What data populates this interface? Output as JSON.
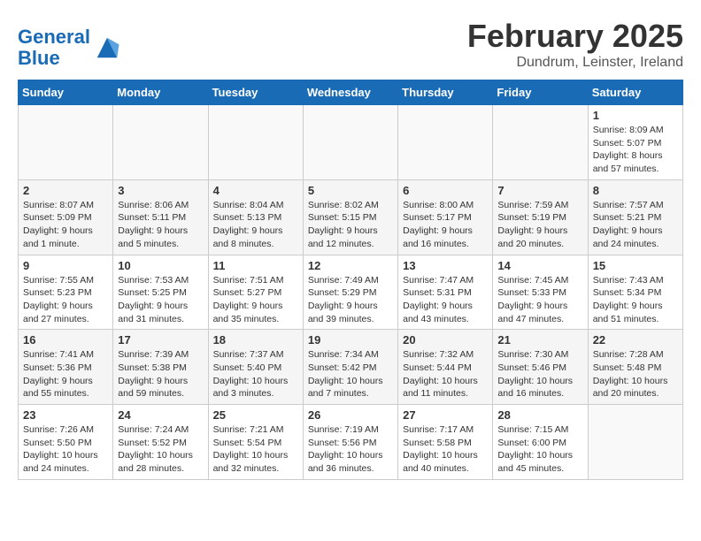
{
  "header": {
    "logo_line1": "General",
    "logo_line2": "Blue",
    "month_year": "February 2025",
    "location": "Dundrum, Leinster, Ireland"
  },
  "weekdays": [
    "Sunday",
    "Monday",
    "Tuesday",
    "Wednesday",
    "Thursday",
    "Friday",
    "Saturday"
  ],
  "weeks": [
    [
      {
        "day": "",
        "info": ""
      },
      {
        "day": "",
        "info": ""
      },
      {
        "day": "",
        "info": ""
      },
      {
        "day": "",
        "info": ""
      },
      {
        "day": "",
        "info": ""
      },
      {
        "day": "",
        "info": ""
      },
      {
        "day": "1",
        "info": "Sunrise: 8:09 AM\nSunset: 5:07 PM\nDaylight: 8 hours and 57 minutes."
      }
    ],
    [
      {
        "day": "2",
        "info": "Sunrise: 8:07 AM\nSunset: 5:09 PM\nDaylight: 9 hours and 1 minute."
      },
      {
        "day": "3",
        "info": "Sunrise: 8:06 AM\nSunset: 5:11 PM\nDaylight: 9 hours and 5 minutes."
      },
      {
        "day": "4",
        "info": "Sunrise: 8:04 AM\nSunset: 5:13 PM\nDaylight: 9 hours and 8 minutes."
      },
      {
        "day": "5",
        "info": "Sunrise: 8:02 AM\nSunset: 5:15 PM\nDaylight: 9 hours and 12 minutes."
      },
      {
        "day": "6",
        "info": "Sunrise: 8:00 AM\nSunset: 5:17 PM\nDaylight: 9 hours and 16 minutes."
      },
      {
        "day": "7",
        "info": "Sunrise: 7:59 AM\nSunset: 5:19 PM\nDaylight: 9 hours and 20 minutes."
      },
      {
        "day": "8",
        "info": "Sunrise: 7:57 AM\nSunset: 5:21 PM\nDaylight: 9 hours and 24 minutes."
      }
    ],
    [
      {
        "day": "9",
        "info": "Sunrise: 7:55 AM\nSunset: 5:23 PM\nDaylight: 9 hours and 27 minutes."
      },
      {
        "day": "10",
        "info": "Sunrise: 7:53 AM\nSunset: 5:25 PM\nDaylight: 9 hours and 31 minutes."
      },
      {
        "day": "11",
        "info": "Sunrise: 7:51 AM\nSunset: 5:27 PM\nDaylight: 9 hours and 35 minutes."
      },
      {
        "day": "12",
        "info": "Sunrise: 7:49 AM\nSunset: 5:29 PM\nDaylight: 9 hours and 39 minutes."
      },
      {
        "day": "13",
        "info": "Sunrise: 7:47 AM\nSunset: 5:31 PM\nDaylight: 9 hours and 43 minutes."
      },
      {
        "day": "14",
        "info": "Sunrise: 7:45 AM\nSunset: 5:33 PM\nDaylight: 9 hours and 47 minutes."
      },
      {
        "day": "15",
        "info": "Sunrise: 7:43 AM\nSunset: 5:34 PM\nDaylight: 9 hours and 51 minutes."
      }
    ],
    [
      {
        "day": "16",
        "info": "Sunrise: 7:41 AM\nSunset: 5:36 PM\nDaylight: 9 hours and 55 minutes."
      },
      {
        "day": "17",
        "info": "Sunrise: 7:39 AM\nSunset: 5:38 PM\nDaylight: 9 hours and 59 minutes."
      },
      {
        "day": "18",
        "info": "Sunrise: 7:37 AM\nSunset: 5:40 PM\nDaylight: 10 hours and 3 minutes."
      },
      {
        "day": "19",
        "info": "Sunrise: 7:34 AM\nSunset: 5:42 PM\nDaylight: 10 hours and 7 minutes."
      },
      {
        "day": "20",
        "info": "Sunrise: 7:32 AM\nSunset: 5:44 PM\nDaylight: 10 hours and 11 minutes."
      },
      {
        "day": "21",
        "info": "Sunrise: 7:30 AM\nSunset: 5:46 PM\nDaylight: 10 hours and 16 minutes."
      },
      {
        "day": "22",
        "info": "Sunrise: 7:28 AM\nSunset: 5:48 PM\nDaylight: 10 hours and 20 minutes."
      }
    ],
    [
      {
        "day": "23",
        "info": "Sunrise: 7:26 AM\nSunset: 5:50 PM\nDaylight: 10 hours and 24 minutes."
      },
      {
        "day": "24",
        "info": "Sunrise: 7:24 AM\nSunset: 5:52 PM\nDaylight: 10 hours and 28 minutes."
      },
      {
        "day": "25",
        "info": "Sunrise: 7:21 AM\nSunset: 5:54 PM\nDaylight: 10 hours and 32 minutes."
      },
      {
        "day": "26",
        "info": "Sunrise: 7:19 AM\nSunset: 5:56 PM\nDaylight: 10 hours and 36 minutes."
      },
      {
        "day": "27",
        "info": "Sunrise: 7:17 AM\nSunset: 5:58 PM\nDaylight: 10 hours and 40 minutes."
      },
      {
        "day": "28",
        "info": "Sunrise: 7:15 AM\nSunset: 6:00 PM\nDaylight: 10 hours and 45 minutes."
      },
      {
        "day": "",
        "info": ""
      }
    ]
  ]
}
